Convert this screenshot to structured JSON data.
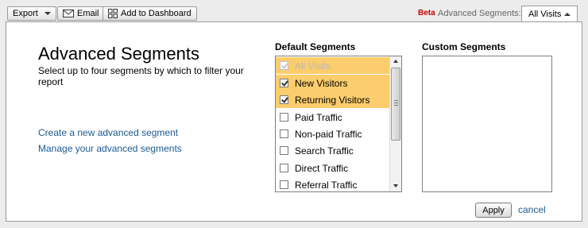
{
  "toolbar": {
    "export_label": "Export",
    "email_label": "Email",
    "dashboard_label": "Add to Dashboard",
    "beta_label": "Beta",
    "advanced_segments_label": "Advanced Segments:",
    "current_segment": "All Visits"
  },
  "panel": {
    "title": "Advanced Segments",
    "subtitle": "Select up to four segments by which to filter your report",
    "links": {
      "create": "Create a new advanced segment",
      "manage": "Manage your advanced segments"
    },
    "default_segments": {
      "heading": "Default Segments",
      "items": [
        {
          "label": "All Visits",
          "checked": true,
          "disabled": true
        },
        {
          "label": "New Visitors",
          "checked": true,
          "disabled": false
        },
        {
          "label": "Returning Visitors",
          "checked": true,
          "disabled": false
        },
        {
          "label": "Paid Traffic",
          "checked": false,
          "disabled": false
        },
        {
          "label": "Non-paid Traffic",
          "checked": false,
          "disabled": false
        },
        {
          "label": "Search Traffic",
          "checked": false,
          "disabled": false
        },
        {
          "label": "Direct Traffic",
          "checked": false,
          "disabled": false
        },
        {
          "label": "Referral Traffic",
          "checked": false,
          "disabled": false
        }
      ]
    },
    "custom_segments": {
      "heading": "Custom Segments"
    },
    "apply_label": "Apply",
    "cancel_label": "cancel"
  },
  "colors": {
    "selected_row": "#fccd6c",
    "link": "#1a5a92",
    "beta": "#cc0000"
  }
}
